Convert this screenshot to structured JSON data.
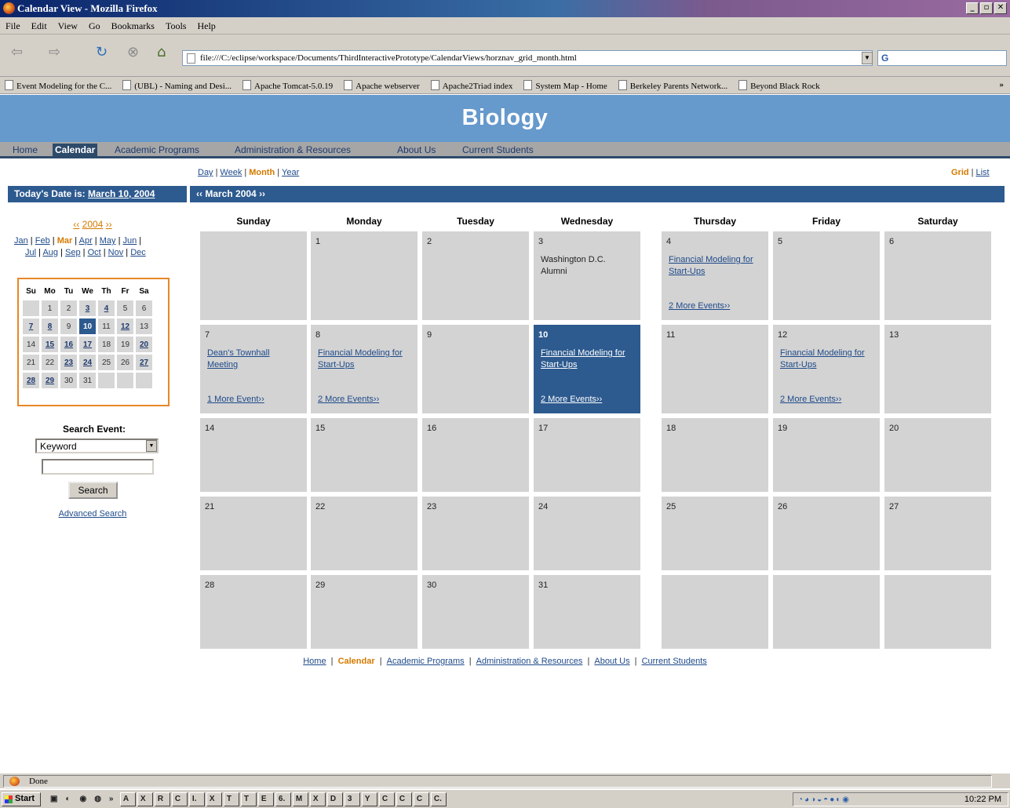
{
  "window": {
    "title": "Calendar View - Mozilla Firefox"
  },
  "menu": [
    "File",
    "Edit",
    "View",
    "Go",
    "Bookmarks",
    "Tools",
    "Help"
  ],
  "url": "file:///C:/eclipse/workspace/Documents/ThirdInteractivePrototype/CalendarViews/horznav_grid_month.html",
  "search_prefix": "G",
  "bookmarks": [
    "Event Modeling for the C...",
    "(UBL) - Naming and Desi...",
    "Apache Tomcat-5.0.19",
    "Apache webserver",
    "Apache2Triad index",
    "System Map - Home",
    "Berkeley Parents Network...",
    "Beyond Black Rock"
  ],
  "bookmarks_more": "»",
  "site": {
    "title": "Biology"
  },
  "topnav": [
    "Home",
    "Calendar",
    "Academic Programs",
    "Administration & Resources",
    "About Us",
    "Current Students"
  ],
  "views": {
    "day": "Day",
    "week": "Week",
    "month": "Month",
    "year": "Year",
    "grid": "Grid",
    "list": "List"
  },
  "today": {
    "label": "Today's Date is:",
    "value": "March 10, 2004"
  },
  "monthbar": {
    "prev": "‹‹",
    "label": "March 2004",
    "next": "››"
  },
  "yearnav": {
    "prev": "‹‹",
    "year": "2004",
    "next": "››"
  },
  "months_row1": [
    "Jan",
    "Feb",
    "Mar",
    "Apr",
    "May",
    "Jun"
  ],
  "months_row2": [
    "Jul",
    "Aug",
    "Sep",
    "Oct",
    "Nov",
    "Dec"
  ],
  "mini_cal": {
    "headers": [
      "Su",
      "Mo",
      "Tu",
      "We",
      "Th",
      "Fr",
      "Sa"
    ],
    "weeks": [
      [
        "",
        "1",
        "2",
        "3",
        "4",
        "5",
        "6"
      ],
      [
        "7",
        "8",
        "9",
        "10",
        "11",
        "12",
        "13"
      ],
      [
        "14",
        "15",
        "16",
        "17",
        "18",
        "19",
        "20"
      ],
      [
        "21",
        "22",
        "23",
        "24",
        "25",
        "26",
        "27"
      ],
      [
        "28",
        "29",
        "30",
        "31",
        "",
        "",
        ""
      ]
    ],
    "event_days": [
      "3",
      "4",
      "7",
      "8",
      "12",
      "15",
      "16",
      "17",
      "20",
      "23",
      "24",
      "27",
      "28",
      "29"
    ],
    "today": "10"
  },
  "search": {
    "label": "Search Event:",
    "select_value": "Keyword",
    "button": "Search",
    "advanced": "Advanced Search"
  },
  "weekdays": [
    "Sunday",
    "Monday",
    "Tuesday",
    "Wednesday",
    "Thursday",
    "Friday",
    "Saturday"
  ],
  "cells": {
    "1": {
      "day": "1"
    },
    "2": {
      "day": "2"
    },
    "3": {
      "day": "3",
      "event": "Washington D.C. Alumni"
    },
    "4": {
      "day": "4",
      "event": "Financial Modeling for Start-Ups",
      "more": "2 More Events››"
    },
    "5": {
      "day": "5"
    },
    "6": {
      "day": "6"
    },
    "7": {
      "day": "7",
      "event": "Dean's Townhall Meeting",
      "more": "1 More Event››"
    },
    "8": {
      "day": "8",
      "event": "Financial Modeling for Start-Ups",
      "more": "2 More Events››"
    },
    "9": {
      "day": "9"
    },
    "10": {
      "day": "10",
      "event": "Financial Modeling for Start-Ups",
      "more": "2 More Events››"
    },
    "11": {
      "day": "11"
    },
    "12": {
      "day": "12",
      "event": "Financial Modeling for Start-Ups",
      "more": "2 More Events››"
    },
    "13": {
      "day": "13"
    },
    "14": {
      "day": "14"
    },
    "15": {
      "day": "15"
    },
    "16": {
      "day": "16"
    },
    "17": {
      "day": "17"
    },
    "18": {
      "day": "18"
    },
    "19": {
      "day": "19"
    },
    "20": {
      "day": "20"
    },
    "21": {
      "day": "21"
    },
    "22": {
      "day": "22"
    },
    "23": {
      "day": "23"
    },
    "24": {
      "day": "24"
    },
    "25": {
      "day": "25"
    },
    "26": {
      "day": "26"
    },
    "27": {
      "day": "27"
    },
    "28": {
      "day": "28"
    },
    "29": {
      "day": "29"
    },
    "30": {
      "day": "30"
    },
    "31": {
      "day": "31"
    }
  },
  "footer_nav": [
    "Home",
    "Calendar",
    "Academic Programs",
    "Administration & Resources",
    "About Us",
    "Current Students"
  ],
  "status": "Done",
  "taskbar": {
    "start": "Start",
    "quick_more": "»",
    "tasks": [
      "A",
      "X",
      "R",
      "C",
      "I.",
      "X",
      "T",
      "T",
      "E",
      "6.",
      "M",
      "X",
      "D",
      "3",
      "Y",
      "C",
      "C",
      "C",
      "C."
    ],
    "clock": "10:22 PM"
  }
}
